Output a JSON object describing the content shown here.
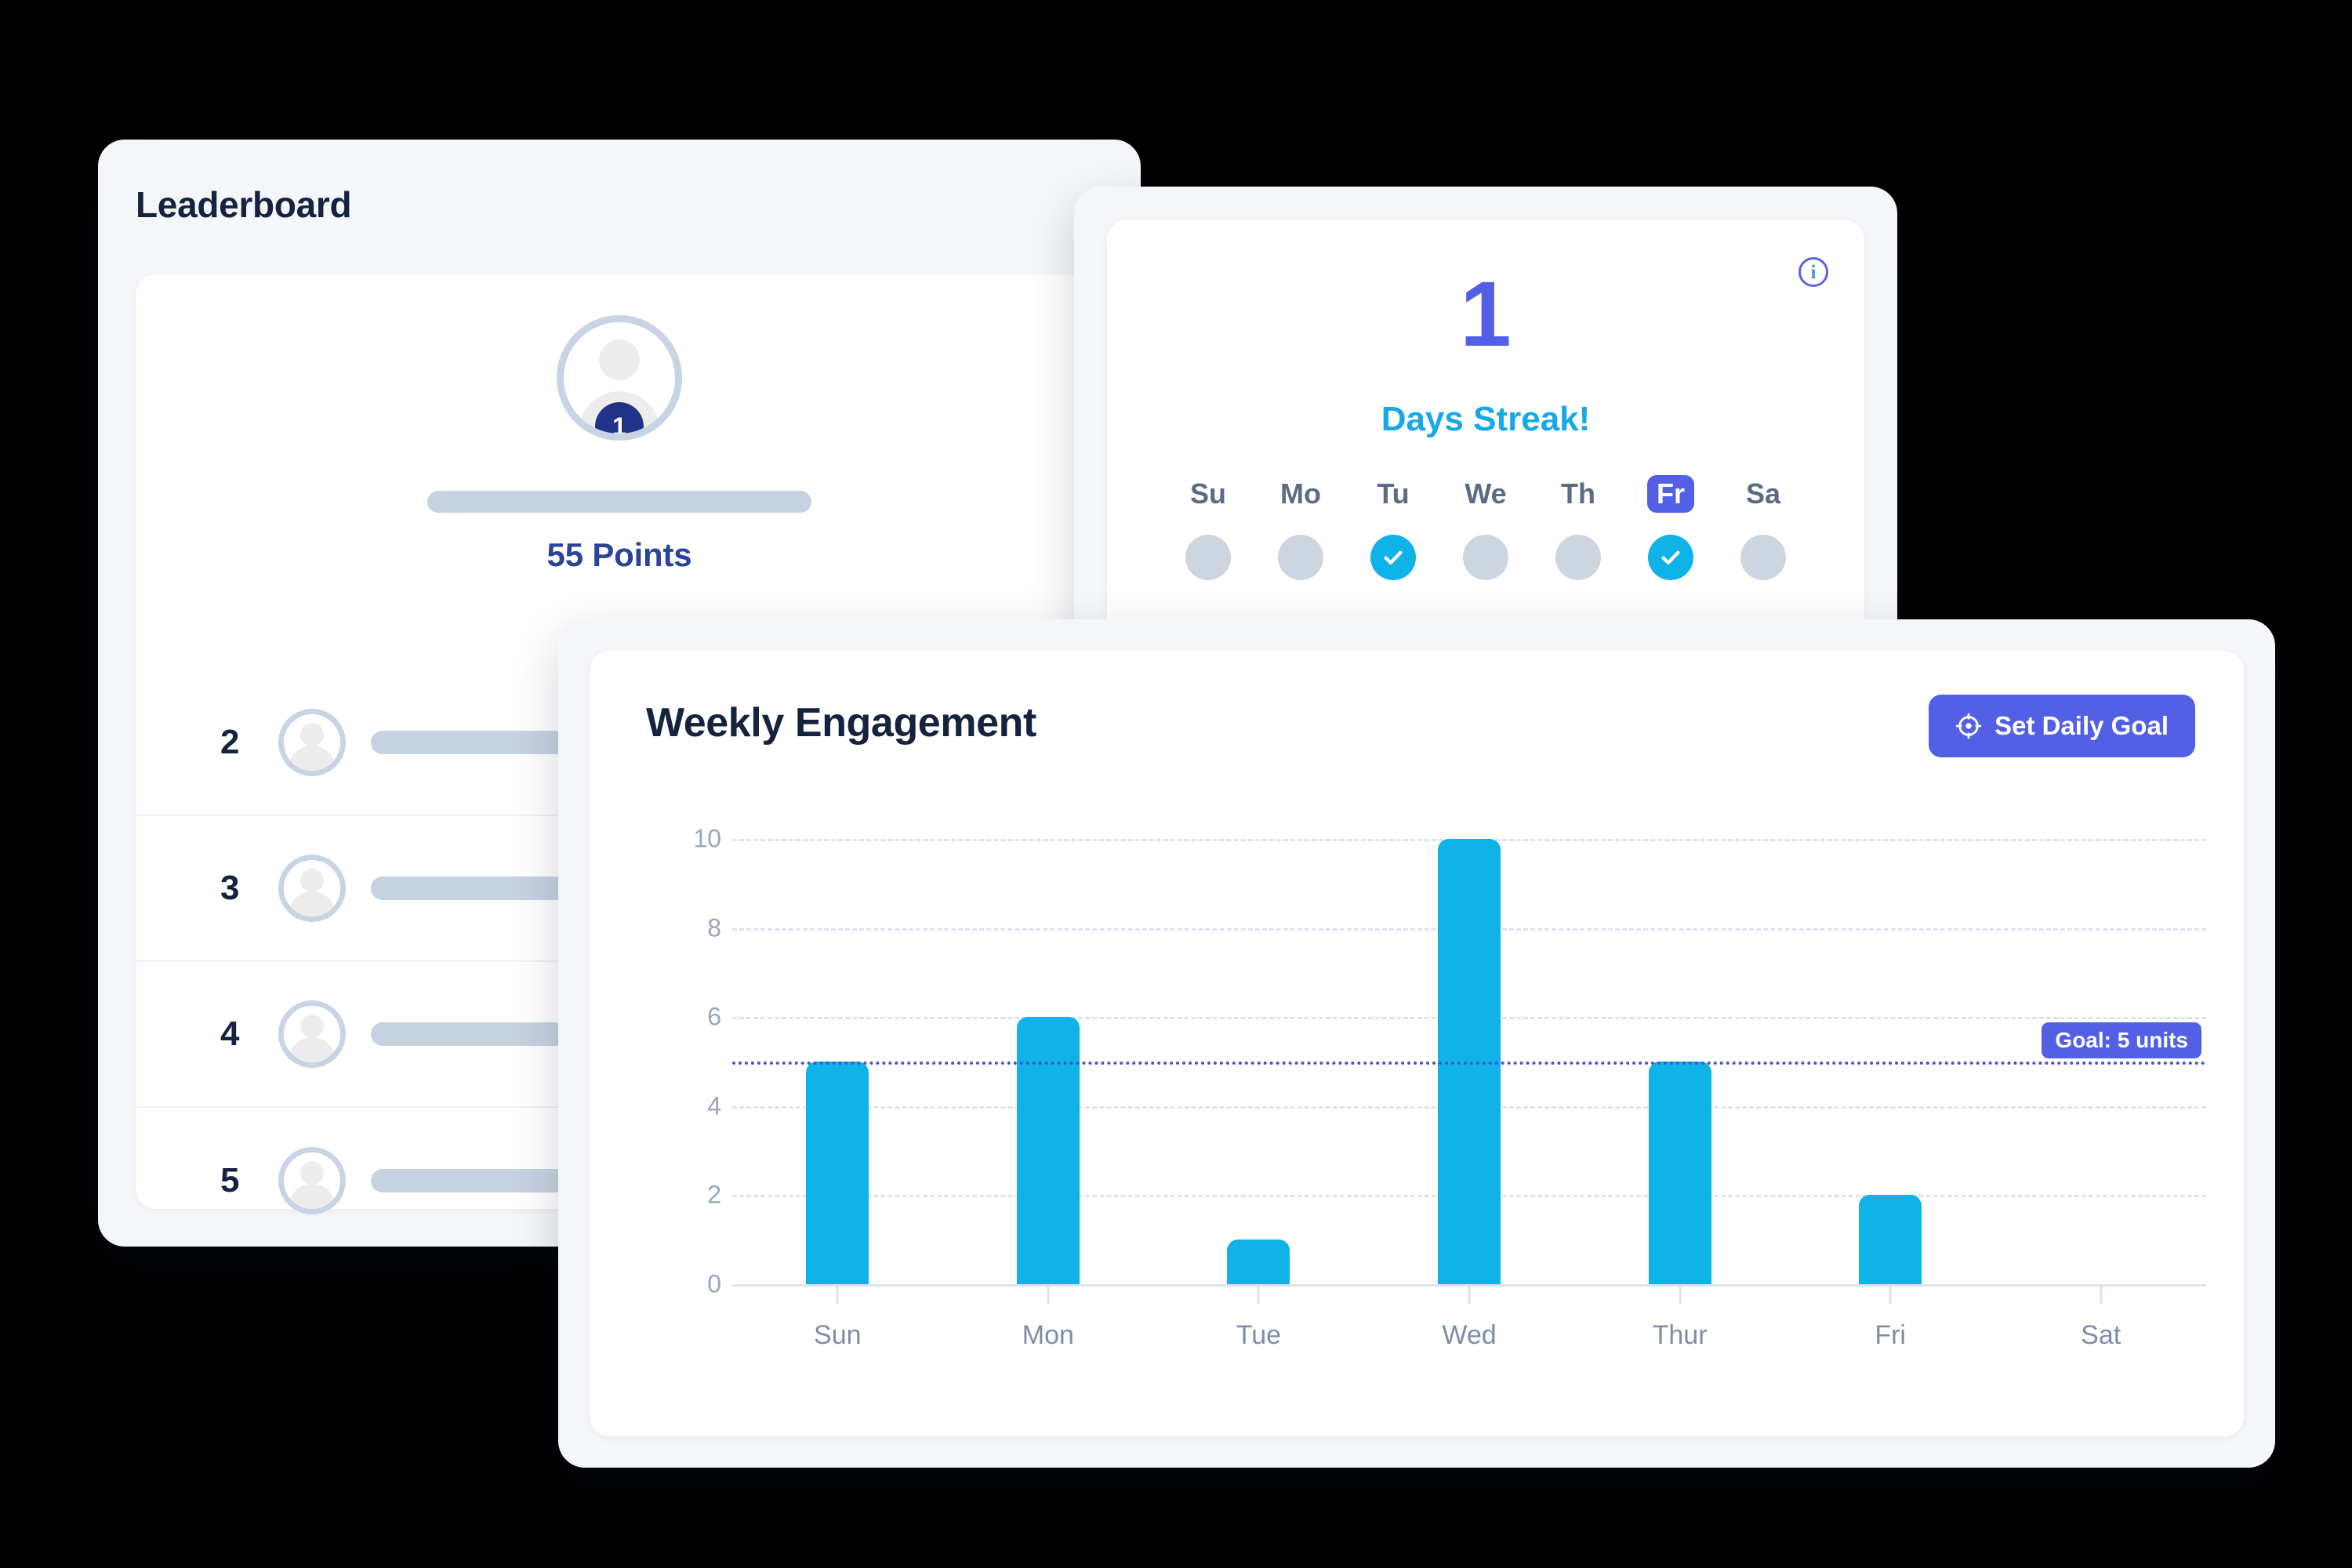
{
  "leaderboard": {
    "title": "Leaderboard",
    "top_user": {
      "rank": "1",
      "points": "55 Points",
      "name_redacted": true
    },
    "rows": [
      {
        "rank": "2"
      },
      {
        "rank": "3"
      },
      {
        "rank": "4"
      },
      {
        "rank": "5"
      }
    ]
  },
  "streak": {
    "count": "1",
    "label": "Days Streak!",
    "info_icon": "info-icon",
    "info_glyph": "i",
    "days": [
      {
        "label": "Su",
        "completed": false,
        "today": false
      },
      {
        "label": "Mo",
        "completed": false,
        "today": false
      },
      {
        "label": "Tu",
        "completed": true,
        "today": false
      },
      {
        "label": "We",
        "completed": false,
        "today": false
      },
      {
        "label": "Th",
        "completed": false,
        "today": false
      },
      {
        "label": "Fr",
        "completed": true,
        "today": true
      },
      {
        "label": "Sa",
        "completed": false,
        "today": false
      }
    ]
  },
  "chart_card": {
    "title": "Weekly Engagement",
    "set_goal_button": {
      "label": "Set Daily Goal",
      "icon": "target-crosshair-icon"
    }
  },
  "chart_data": {
    "type": "bar",
    "title": "Weekly Engagement",
    "xlabel": "",
    "ylabel": "",
    "categories": [
      "Sun",
      "Mon",
      "Tue",
      "Wed",
      "Thur",
      "Fri",
      "Sat"
    ],
    "values": [
      5,
      6,
      1,
      10,
      5,
      2,
      0
    ],
    "yticks": [
      0,
      2,
      4,
      6,
      8,
      10
    ],
    "ylim": [
      0,
      10
    ],
    "grid": true,
    "legend": "none",
    "bar_color": "#0fb3e8",
    "goal": {
      "value": 5,
      "label": "Goal: 5 units",
      "line_color": "#4652d8"
    }
  },
  "colors": {
    "accent_blue": "#0fb3e8",
    "accent_indigo": "#5360e6",
    "navy": "#16233f",
    "badge_navy": "#1f3286",
    "muted": "#c7d2e1",
    "card_bg": "#f4f6f9",
    "page_bg": "#000000"
  }
}
